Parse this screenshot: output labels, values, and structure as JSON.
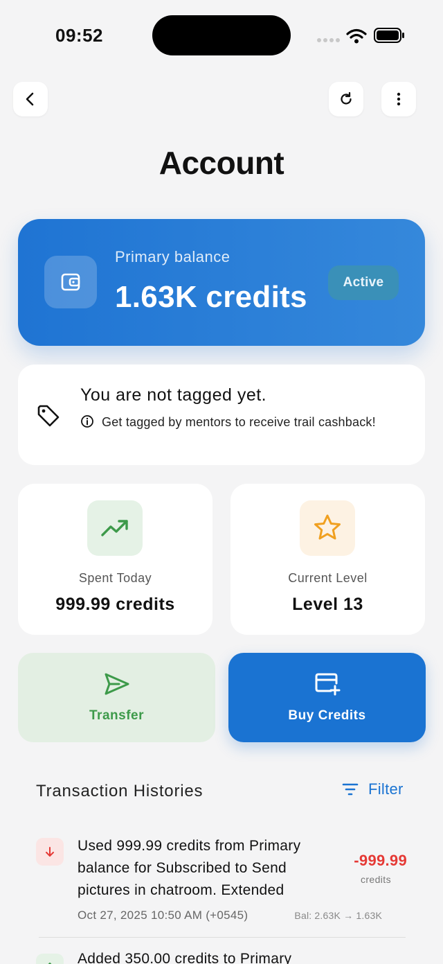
{
  "status_bar": {
    "time": "09:52"
  },
  "header": {
    "title": "Account"
  },
  "balance": {
    "label": "Primary balance",
    "value": "1.63K credits",
    "badge": "Active",
    "color": "#1f74d3"
  },
  "tag_notice": {
    "title": "You are not tagged yet.",
    "description": "Get tagged by mentors to receive trail cashback!"
  },
  "stats": [
    {
      "label": "Spent Today",
      "value": "999.99 credits",
      "icon": "trending-up-icon",
      "color": "#3d9a4a"
    },
    {
      "label": "Current Level",
      "value": "Level 13",
      "icon": "star-icon",
      "color": "#f0a020"
    }
  ],
  "actions": {
    "transfer_label": "Transfer",
    "buy_label": "Buy Credits"
  },
  "transactions": {
    "title": "Transaction Histories",
    "filter_label": "Filter",
    "items": [
      {
        "direction": "debit",
        "description": "Used 999.99 credits from Primary balance for Subscribed to Send pictures in chatroom. Extended",
        "amount": "-999.99",
        "unit": "credits",
        "date": "Oct 27, 2025 10:50 AM (+0545)",
        "balance": "Bal: 2.63K → 1.63K",
        "color": "#e53935"
      },
      {
        "direction": "credit",
        "description": "Added 350.00 credits to Primary",
        "color": "#3d9a4a"
      }
    ]
  }
}
